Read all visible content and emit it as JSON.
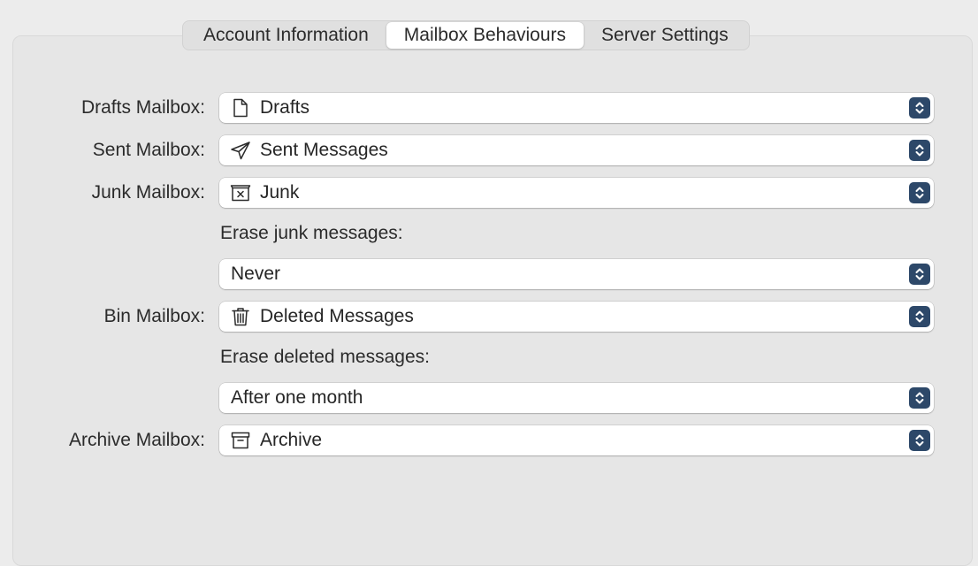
{
  "tabs": [
    {
      "label": "Account Information",
      "selected": false
    },
    {
      "label": "Mailbox Behaviours",
      "selected": true
    },
    {
      "label": "Server Settings",
      "selected": false
    }
  ],
  "drafts": {
    "label": "Drafts Mailbox:",
    "value": "Drafts",
    "icon": "document-icon"
  },
  "sent": {
    "label": "Sent Mailbox:",
    "value": "Sent Messages",
    "icon": "paper-plane-icon"
  },
  "junk": {
    "label": "Junk Mailbox:",
    "value": "Junk",
    "icon": "junk-box-icon",
    "erase_label": "Erase junk messages:",
    "erase_value": "Never"
  },
  "bin": {
    "label": "Bin Mailbox:",
    "value": "Deleted Messages",
    "icon": "trash-icon",
    "erase_label": "Erase deleted messages:",
    "erase_value": "After one month"
  },
  "archive": {
    "label": "Archive Mailbox:",
    "value": "Archive",
    "icon": "archive-box-icon"
  },
  "colors": {
    "stepper": "#2d4869",
    "panel": "#e6e6e6",
    "window": "#ececec"
  }
}
